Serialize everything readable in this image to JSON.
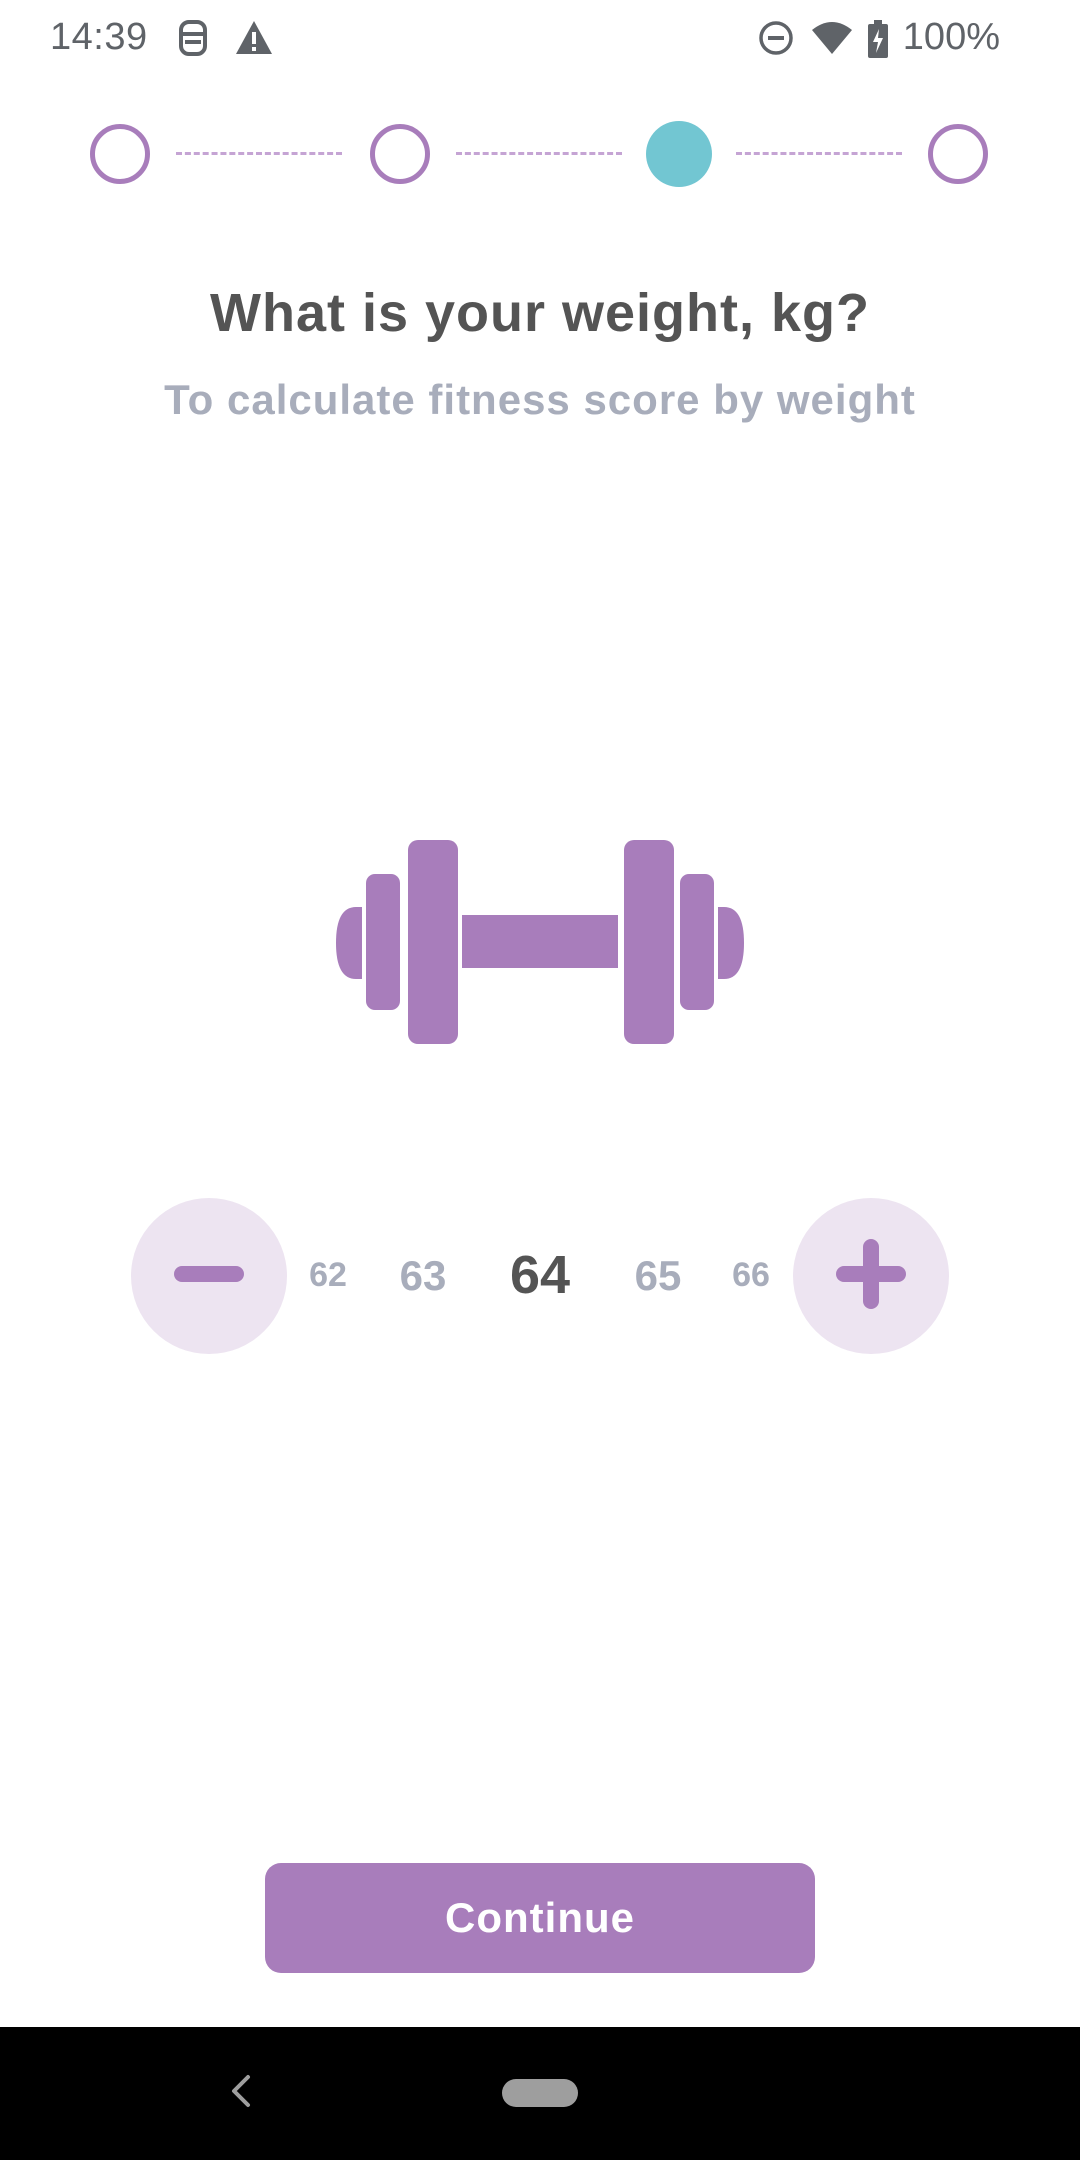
{
  "status_bar": {
    "time": "14:39",
    "icons": [
      "face-id-icon",
      "warning-icon",
      "do-not-disturb-icon",
      "wifi-icon",
      "battery-charging-icon"
    ],
    "battery": "100%"
  },
  "stepper": {
    "total_steps": 4,
    "current_step": 3
  },
  "question": {
    "title": "What is your weight, kg?",
    "subtitle": "To calculate fitness score by weight"
  },
  "weight_picker": {
    "values": [
      "62",
      "63",
      "64",
      "65",
      "66"
    ],
    "selected": "64",
    "minus_icon": "minus-icon",
    "plus_icon": "plus-icon"
  },
  "continue_button": {
    "label": "Continue"
  },
  "colors": {
    "accent": "#a87dbb",
    "active_step": "#72c6d2",
    "light_accent": "#ede4f1",
    "title": "#545454",
    "muted": "#a8adbb"
  },
  "nav_bar": {
    "icons": [
      "back-icon",
      "home-pill-icon"
    ]
  }
}
